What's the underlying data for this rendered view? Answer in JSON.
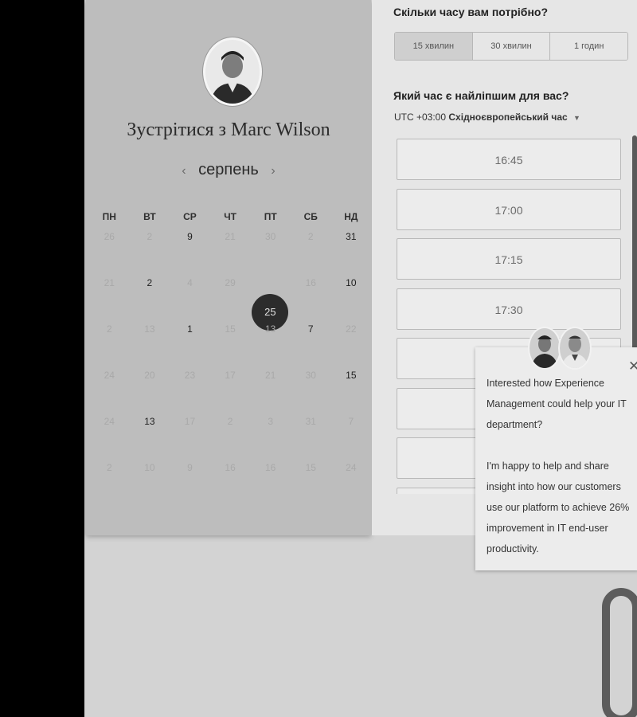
{
  "calendar": {
    "title_prefix": "Зустрітися з",
    "host_name": "Marc Wilson",
    "month": "серпень",
    "prev_icon": "‹",
    "next_icon": "›",
    "weekdays": [
      "ПН",
      "ВТ",
      "СР",
      "ЧТ",
      "ПТ",
      "СБ",
      "НД"
    ],
    "weeks": [
      [
        {
          "d": "26",
          "s": "dim"
        },
        {
          "d": "2",
          "s": "dim"
        },
        {
          "d": "9",
          "s": "avail"
        },
        {
          "d": "21",
          "s": "dim"
        },
        {
          "d": "30",
          "s": "dim"
        },
        {
          "d": "2",
          "s": "dim"
        },
        {
          "d": "31",
          "s": "avail"
        }
      ],
      [
        {
          "d": "21",
          "s": "dim"
        },
        {
          "d": "2",
          "s": "avail"
        },
        {
          "d": "4",
          "s": "dim"
        },
        {
          "d": "29",
          "s": "dim"
        },
        {
          "d": "25",
          "s": "sel"
        },
        {
          "d": "16",
          "s": "dim"
        },
        {
          "d": "10",
          "s": "avail"
        }
      ],
      [
        {
          "d": "2",
          "s": "dim"
        },
        {
          "d": "13",
          "s": "dim"
        },
        {
          "d": "1",
          "s": "avail"
        },
        {
          "d": "15",
          "s": "dim"
        },
        {
          "d": "13",
          "s": "dim"
        },
        {
          "d": "7",
          "s": "avail"
        },
        {
          "d": "22",
          "s": "dim"
        }
      ],
      [
        {
          "d": "24",
          "s": "dim"
        },
        {
          "d": "20",
          "s": "dim"
        },
        {
          "d": "23",
          "s": "dim"
        },
        {
          "d": "17",
          "s": "dim"
        },
        {
          "d": "21",
          "s": "dim"
        },
        {
          "d": "30",
          "s": "dim"
        },
        {
          "d": "15",
          "s": "avail"
        }
      ],
      [
        {
          "d": "24",
          "s": "dim"
        },
        {
          "d": "13",
          "s": "avail"
        },
        {
          "d": "17",
          "s": "dim"
        },
        {
          "d": "2",
          "s": "dim"
        },
        {
          "d": "3",
          "s": "dim"
        },
        {
          "d": "31",
          "s": "dim"
        },
        {
          "d": "7",
          "s": "dim"
        }
      ],
      [
        {
          "d": "2",
          "s": "dim"
        },
        {
          "d": "10",
          "s": "dim"
        },
        {
          "d": "9",
          "s": "dim"
        },
        {
          "d": "16",
          "s": "dim"
        },
        {
          "d": "16",
          "s": "dim"
        },
        {
          "d": "15",
          "s": "dim"
        },
        {
          "d": "24",
          "s": "dim"
        }
      ]
    ]
  },
  "booking": {
    "duration_question": "Скільки часу вам потрібно?",
    "durations": [
      "15 хвилин",
      "30 хвилин",
      "1 годин"
    ],
    "selected_duration": "15 хвилин",
    "time_question": "Який час є найліпшим для вас?",
    "timezone_offset": "UTC +03:00",
    "timezone_name": "Східноєвропейський час",
    "slots": [
      "16:45",
      "17:00",
      "17:15",
      "17:30",
      "",
      "",
      "",
      ""
    ]
  },
  "chat": {
    "message_1": "Interested how Experience Management could help your IT department?",
    "message_2": "I'm happy to help and share insight into how our customers use our platform to achieve 26% improvement in IT end-user productivity.",
    "close_icon": "✕"
  }
}
